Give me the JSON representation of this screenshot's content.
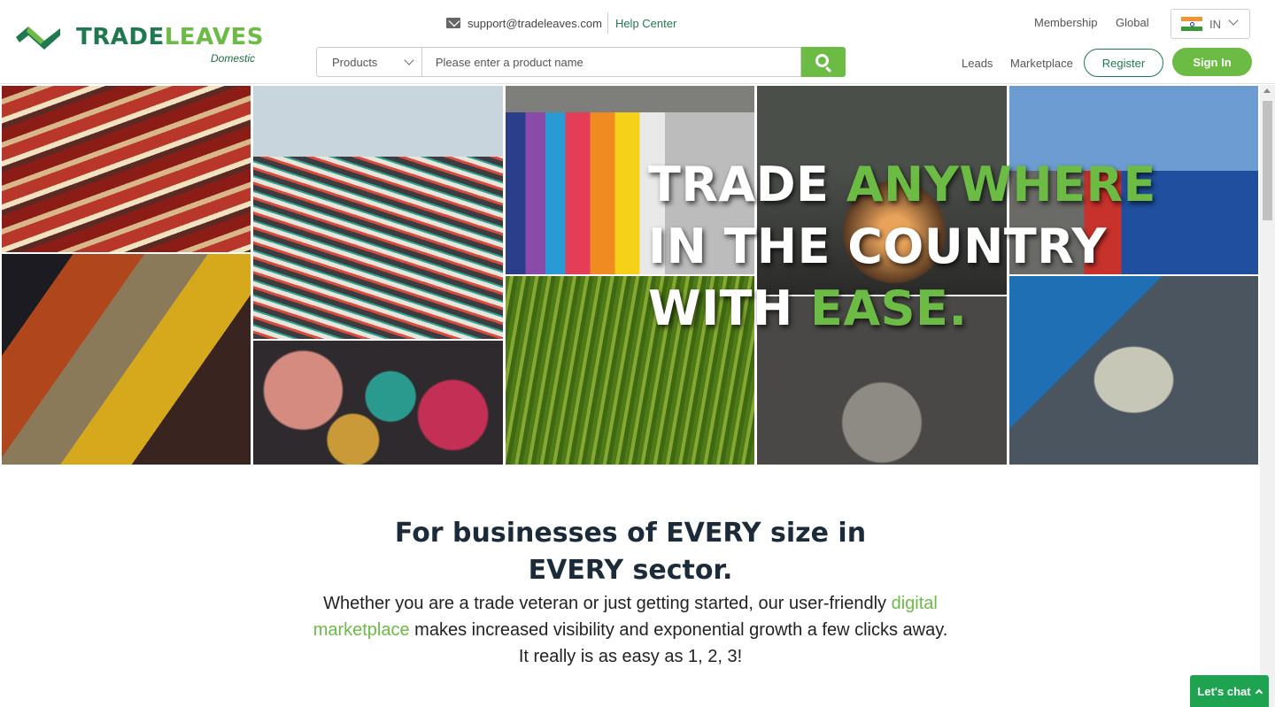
{
  "brand": {
    "name_part1": "TRADE",
    "name_part2": "LEAVES",
    "subtitle": "Domestic",
    "primary_color": "#1e7a4e",
    "accent_color": "#6cbb45"
  },
  "contact": {
    "email": "support@tradeleaves.com",
    "help": "Help Center"
  },
  "search": {
    "category": "Products",
    "placeholder": "Please enter a product name"
  },
  "nav": {
    "membership": "Membership",
    "global": "Global",
    "leads": "Leads",
    "marketplace": "Marketplace",
    "country": "IN",
    "register": "Register",
    "signin": "Sign In"
  },
  "hero": {
    "line1_a": "TRADE ",
    "line1_b": "ANYWHERE",
    "line2": "IN THE COUNTRY",
    "line3_a": "WITH ",
    "line3_b": "EASE."
  },
  "intro": {
    "title_line1": "For businesses of EVERY size in",
    "title_line2": "EVERY sector.",
    "text_before": "Whether you are a trade veteran or just getting started, our user-friendly ",
    "link": "digital marketplace",
    "text_after": " makes increased visibility and exponential growth a few clicks away. It really is as easy as 1, 2, 3!"
  },
  "chat": {
    "label": "Let's chat"
  }
}
